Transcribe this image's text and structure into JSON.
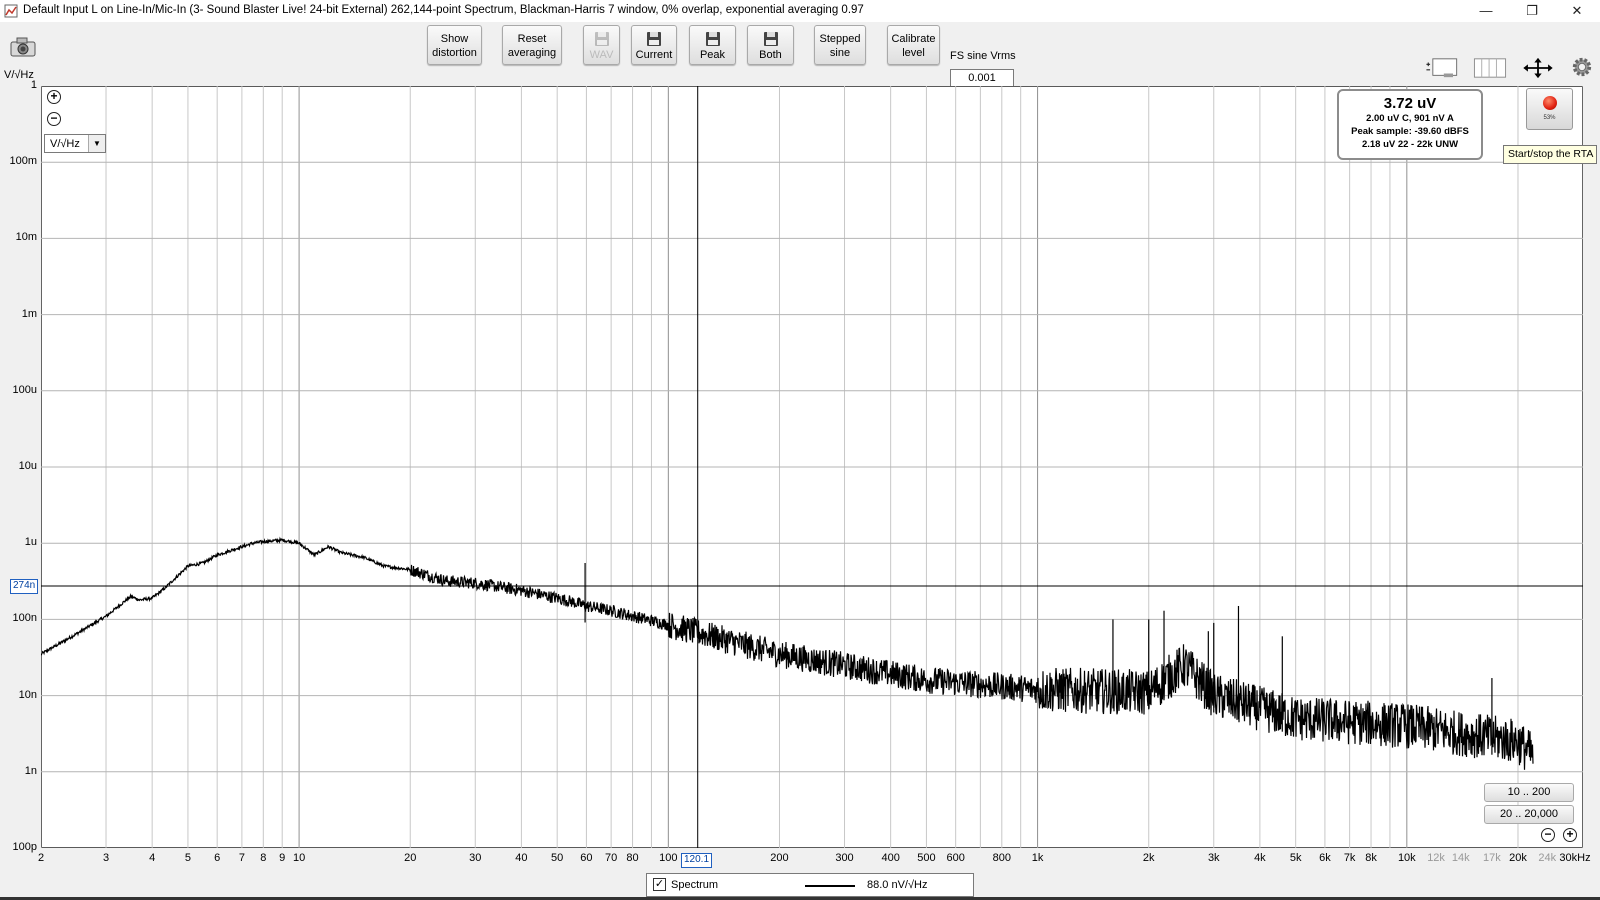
{
  "window": {
    "title": "Default Input L on Line-In/Mic-In (3- Sound Blaster Live! 24-bit External) 262,144-point Spectrum, Blackman-Harris 7 window, 0% overlap, exponential averaging 0.97",
    "minimize": "—",
    "restore": "❐",
    "close": "✕"
  },
  "toolbar": {
    "buttons": [
      {
        "id": "show-distortion",
        "line1": "Show",
        "line2": "distortion",
        "x": 427,
        "w": 55
      },
      {
        "id": "reset-averaging",
        "line1": "Reset",
        "line2": "averaging",
        "x": 502,
        "w": 60
      }
    ],
    "icon_buttons": [
      {
        "id": "wav",
        "label": "WAV",
        "disabled": true,
        "x": 583,
        "w": 37
      },
      {
        "id": "current",
        "label": "Current",
        "disabled": false,
        "x": 631,
        "w": 46
      },
      {
        "id": "peak",
        "label": "Peak",
        "disabled": false,
        "x": 689,
        "w": 47
      },
      {
        "id": "both",
        "label": "Both",
        "disabled": false,
        "x": 747,
        "w": 47
      }
    ],
    "buttons2": [
      {
        "id": "stepped-sine",
        "line1": "Stepped",
        "line2": "sine",
        "x": 814,
        "w": 52
      },
      {
        "id": "calibrate-level",
        "line1": "Calibrate",
        "line2": "level",
        "x": 887,
        "w": 53
      }
    ],
    "fs_label": "FS sine Vrms",
    "fs_value": "0.001"
  },
  "plot": {
    "unit_label": "V/√Hz",
    "unit_select": "V/√Hz",
    "y_marker": "274n",
    "x_marker": "120.1",
    "y_ticks": [
      "1",
      "100m",
      "10m",
      "1m",
      "100u",
      "10u",
      "1u",
      "100n",
      "10n",
      "1n",
      "100p"
    ],
    "x_ticks_major": [
      "2",
      "3",
      "4",
      "5",
      "6",
      "7",
      "8",
      "9",
      "10",
      "20",
      "30",
      "40",
      "50",
      "60",
      "70",
      "80",
      "100",
      "200",
      "300",
      "400",
      "500",
      "600",
      "800",
      "1k",
      "2k",
      "3k",
      "4k",
      "5k",
      "6k",
      "7k",
      "8k",
      "10k",
      "20k",
      "30kHz"
    ],
    "x_ticks_minor": [
      "12k",
      "14k",
      "17k",
      "24k"
    ]
  },
  "infobox": {
    "rms": "3.72 uV",
    "line2": "2.00 uV C, 901 nV A",
    "line3": "Peak sample: -39.60 dBFS",
    "line4": "2.18 uV 22 - 22k UNW"
  },
  "rta": {
    "pct": "53%",
    "tooltip": "Start/stop the RTA"
  },
  "ranges": {
    "r1": "10 .. 200",
    "r2": "20 .. 20,000"
  },
  "legend": {
    "name": "Spectrum",
    "checked": "✓",
    "value": "88.0 nV/√Hz"
  },
  "chart_data": {
    "type": "line",
    "xscale": "log",
    "yscale": "log",
    "xlim": [
      2,
      30000
    ],
    "ylim": [
      1e-10,
      1
    ],
    "ylabel": "V/√Hz",
    "cursor": {
      "x": 120.1,
      "y": 2.74e-07
    },
    "series": [
      {
        "name": "Spectrum",
        "x": [
          2,
          2.5,
          3,
          3.5,
          3.7,
          4,
          4.3,
          5,
          5.5,
          6,
          7,
          7.5,
          8,
          9,
          10,
          11,
          12,
          13,
          15,
          17,
          20,
          25,
          30,
          40,
          50,
          55,
          60,
          70,
          100,
          200,
          500,
          1000,
          2000,
          2500,
          3000,
          5000,
          10000,
          20000,
          22000
        ],
        "y": [
          3.5e-08,
          6.5e-08,
          1.1e-07,
          2e-07,
          1.8e-07,
          1.9e-07,
          2.5e-07,
          5e-07,
          5.5e-07,
          7e-07,
          9e-07,
          1e-06,
          1.05e-06,
          1.1e-06,
          1e-06,
          7e-07,
          9e-07,
          7.5e-07,
          6.5e-07,
          5e-07,
          4.5e-07,
          3.2e-07,
          3e-07,
          2.4e-07,
          1.9e-07,
          1.7e-07,
          1.5e-07,
          1.3e-07,
          8.5e-08,
          3.5e-08,
          1.6e-08,
          1.2e-08,
          1.1e-08,
          2.5e-08,
          1e-08,
          5e-09,
          4e-09,
          2.5e-09,
          1.6e-09
        ]
      }
    ]
  }
}
